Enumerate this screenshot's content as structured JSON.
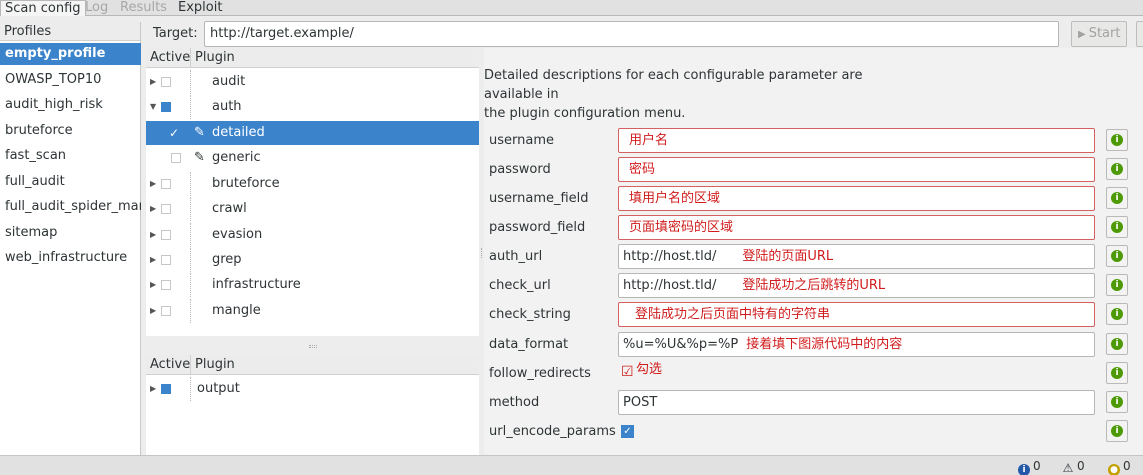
{
  "tabs": [
    "Scan config",
    "Log",
    "Results",
    "Exploit"
  ],
  "profiles": {
    "header": "Profiles",
    "items": [
      "empty_profile",
      "OWASP_TOP10",
      "audit_high_risk",
      "bruteforce",
      "fast_scan",
      "full_audit",
      "full_audit_spider_man",
      "sitemap",
      "web_infrastructure"
    ]
  },
  "target": {
    "label": "Target:",
    "value": "http://target.example/",
    "start_label": "Start"
  },
  "plugins_top": {
    "col_active": "Active",
    "col_plugin": "Plugin",
    "rows": [
      {
        "name": "audit"
      },
      {
        "name": "auth"
      },
      {
        "name": "detailed"
      },
      {
        "name": "generic"
      },
      {
        "name": "bruteforce"
      },
      {
        "name": "crawl"
      },
      {
        "name": "evasion"
      },
      {
        "name": "grep"
      },
      {
        "name": "infrastructure"
      },
      {
        "name": "mangle"
      }
    ]
  },
  "plugins_bottom": {
    "col_active": "Active",
    "col_plugin": "Plugin",
    "rows": [
      {
        "name": "output"
      }
    ]
  },
  "config": {
    "description_line1": "Detailed descriptions for each configurable parameter are available in",
    "description_line2": "the plugin configuration menu.",
    "params": [
      {
        "label": "username",
        "value": "",
        "note": "用户名"
      },
      {
        "label": "password",
        "value": "",
        "note": "密码"
      },
      {
        "label": "username_field",
        "value": "",
        "note": "填用户名的区域"
      },
      {
        "label": "password_field",
        "value": "",
        "note": "页面填密码的区域"
      },
      {
        "label": "auth_url",
        "value": "http://host.tld/",
        "note": "登陆的页面URL"
      },
      {
        "label": "check_url",
        "value": "http://host.tld/",
        "note": "登陆成功之后跳转的URL"
      },
      {
        "label": "check_string",
        "value": "",
        "note": "登陆成功之后页面中特有的字符串"
      },
      {
        "label": "data_format",
        "value": "%u=%U&%p=%P",
        "note": "接着填下图源代码中的内容"
      },
      {
        "label": "follow_redirects",
        "note": "勾选"
      },
      {
        "label": "method",
        "value": "POST"
      },
      {
        "label": "url_encode_params"
      }
    ]
  },
  "status": {
    "info_count": "0",
    "warning_count": "0",
    "bug_count": "0"
  },
  "colors": {
    "selection": "#3b83cb",
    "annotation": "#d01c1c",
    "help_icon": "#4e9a06"
  }
}
